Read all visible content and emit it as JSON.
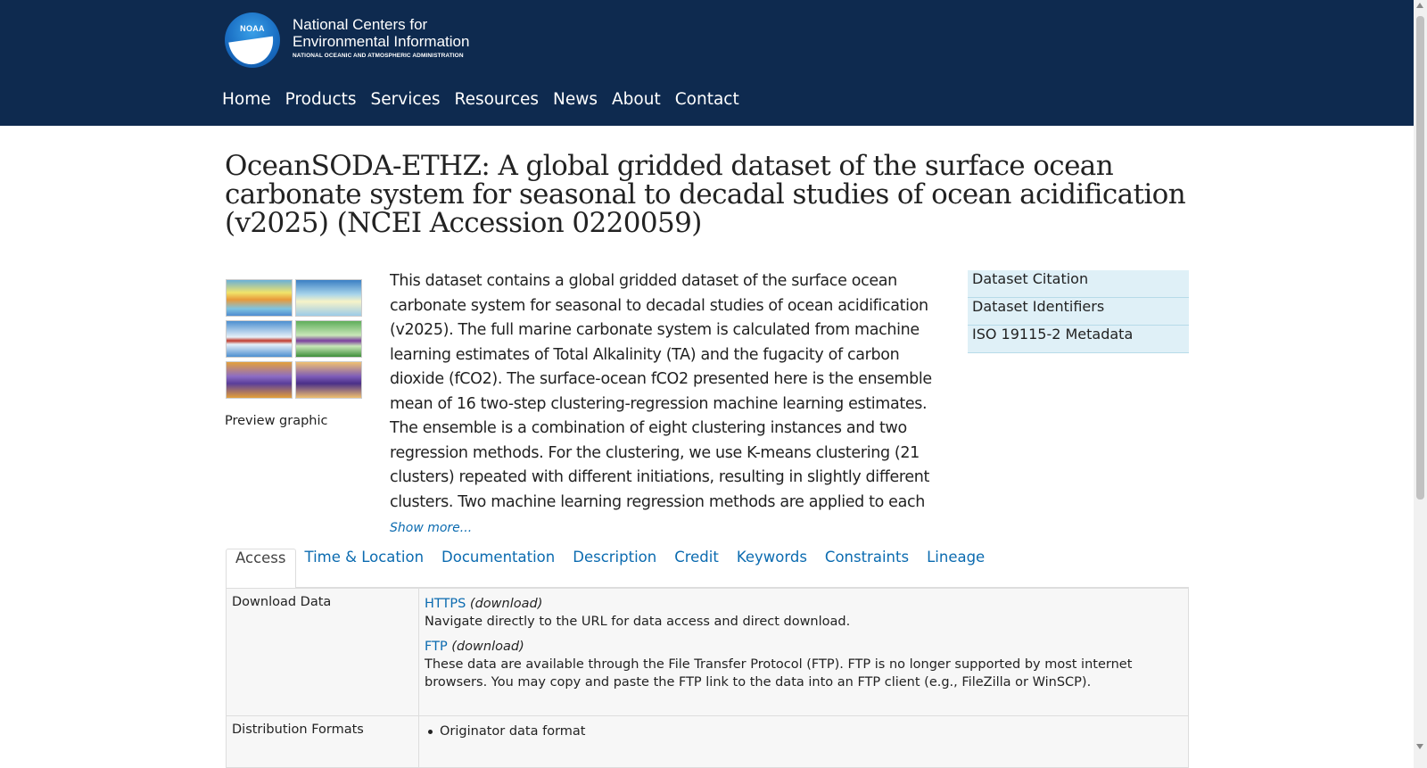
{
  "header": {
    "logo_text": "NOAA",
    "brand_line1": "National Centers for",
    "brand_line2": "Environmental Information",
    "brand_line3": "NATIONAL OCEANIC AND ATMOSPHERIC ADMINISTRATION",
    "nav": [
      "Home",
      "Products",
      "Services",
      "Resources",
      "News",
      "About",
      "Contact"
    ]
  },
  "page": {
    "title": "OceanSODA-ETHZ: A global gridded dataset of the surface ocean carbonate system for seasonal to decadal studies of ocean acidification (v2025) (NCEI Accession 0220059)",
    "preview_caption": "Preview graphic",
    "description": "This dataset contains a global gridded dataset of the surface ocean carbonate system for seasonal to decadal studies of ocean acidification (v2025). The full marine carbonate system is calculated from machine learning estimates of Total Alkalinity (TA) and the fugacity of carbon dioxide (fCO2). The surface-ocean fCO2 presented here is the ensemble mean of 16 two-step clustering-regression machine learning estimates. The ensemble is a combination of eight clustering instances and two regression methods. For the clustering, we use K-means clustering (21 clusters) repeated with different initiations, resulting in slightly different clusters. Two machine learning regression methods are applied to each of these clustering instances. These machine",
    "show_more": "Show more..."
  },
  "side_links": [
    "Dataset Citation",
    "Dataset Identifiers",
    "ISO 19115-2 Metadata"
  ],
  "tabs": [
    "Access",
    "Time & Location",
    "Documentation",
    "Description",
    "Credit",
    "Keywords",
    "Constraints",
    "Lineage"
  ],
  "access": {
    "download_label": "Download Data",
    "https_link": "HTTPS",
    "https_note": "(download)",
    "https_desc": "Navigate directly to the URL for data access and direct download.",
    "ftp_link": "FTP",
    "ftp_note": "(download)",
    "ftp_desc": "These data are available through the File Transfer Protocol (FTP). FTP is no longer supported by most internet browsers. You may copy and paste the FTP link to the data into an FTP client (e.g., FileZilla or WinSCP).",
    "formats_label": "Distribution Formats",
    "formats": [
      "Originator data format"
    ]
  },
  "colors": {
    "header_bg": "#0e2a4f",
    "link": "#0b6bb0",
    "side_bg": "#dff0f7"
  }
}
